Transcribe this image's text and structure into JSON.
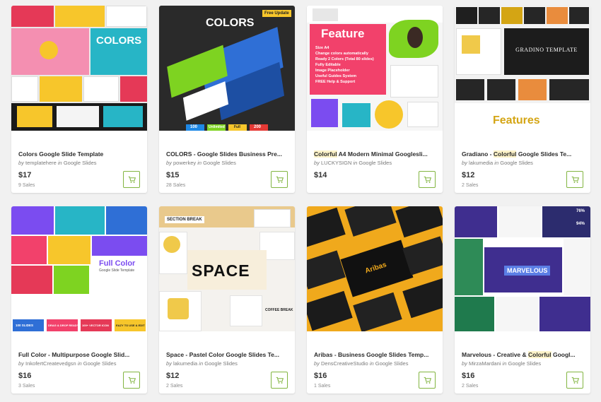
{
  "colors": {
    "accent": "#82b541",
    "highlight": "#fdf3c9",
    "page_bg": "#f1f1f1"
  },
  "cart_icon": "shopping-cart-icon",
  "products": [
    {
      "title": "Colors Google Slide Template",
      "by": "by",
      "author": "templatehere",
      "in": "in",
      "category": "Google Slides",
      "price": "$17",
      "sales": "9 Sales",
      "thumb": {
        "word": "COLORS"
      }
    },
    {
      "title": "COLORS - Google Slides Business Pre...",
      "by": "by",
      "author": "powerkey",
      "in": "in",
      "category": "Google Slides",
      "price": "$15",
      "sales": "28 Sales",
      "thumb": {
        "logo": "COLORS",
        "badge": "Free Update",
        "stats": [
          "100",
          "Unlimited",
          "Full",
          "200"
        ],
        "stat_captions": [
          "Unique Slides",
          "Colors",
          "Animated",
          "Icons"
        ]
      }
    },
    {
      "title_pre": "",
      "title_hl": "Colorful",
      "title_post": " A4 Modern Minimal Googlesli...",
      "by": "by",
      "author": "LUCKYSIGN",
      "in": "in",
      "category": "Google Slides",
      "price": "$14",
      "sales": "",
      "thumb": {
        "heading": "Feature",
        "features": [
          "Size A4",
          "Change colors automatically",
          "Ready 2 Colors (Total 80 slides)",
          "Fully Editable",
          "Image Placeholder",
          "Useful Guides System",
          "FREE Help & Support"
        ]
      }
    },
    {
      "title_pre": "Gradiano - ",
      "title_hl": "Colorful",
      "title_post": " Google Slides Te...",
      "by": "by",
      "author": "lakumedia",
      "in": "in",
      "category": "Google Slides",
      "price": "$12",
      "sales": "2 Sales",
      "thumb": {
        "banner": "GRADINO TEMPLATE",
        "heading": "Features"
      }
    },
    {
      "title": "Full Color - Multipurpose Google Slid...",
      "by": "by",
      "author": "InkofertCreatevedgsn",
      "in": "in",
      "category": "Google Slides",
      "price": "$16",
      "sales": "3 Sales",
      "thumb": {
        "heading": "Full Color",
        "sub": "Google Slide Template",
        "boxes": [
          "100 SLIDES",
          "DRAG & DROP READY",
          "100+ VECTOR ICON",
          "EAZY TO USE & EDIT"
        ]
      }
    },
    {
      "title": "Space - Pastel Color Google Slides Te...",
      "by": "by",
      "author": "lakumedia",
      "in": "in",
      "category": "Google Slides",
      "price": "$12",
      "sales": "2 Sales",
      "thumb": {
        "word": "SPACE",
        "tag1": "SECTION BREAK",
        "tag2": "COFFEE BREAK"
      }
    },
    {
      "title": "Aribas - Business Google Slides Temp...",
      "by": "by",
      "author": "DensCreativeStudio",
      "in": "in",
      "category": "Google Slides",
      "price": "$16",
      "sales": "1 Sales",
      "thumb": {
        "word": "Aribas"
      }
    },
    {
      "title_pre": "Marvelous - Creative & ",
      "title_hl": "Colorful",
      "title_post": " Googl...",
      "by": "by",
      "author": "MirzaMardani",
      "in": "in",
      "category": "Google Slides",
      "price": "$16",
      "sales": "2 Sales",
      "thumb": {
        "word": "MARVELOUS",
        "stat1": "76%",
        "stat2": "94%"
      }
    }
  ]
}
